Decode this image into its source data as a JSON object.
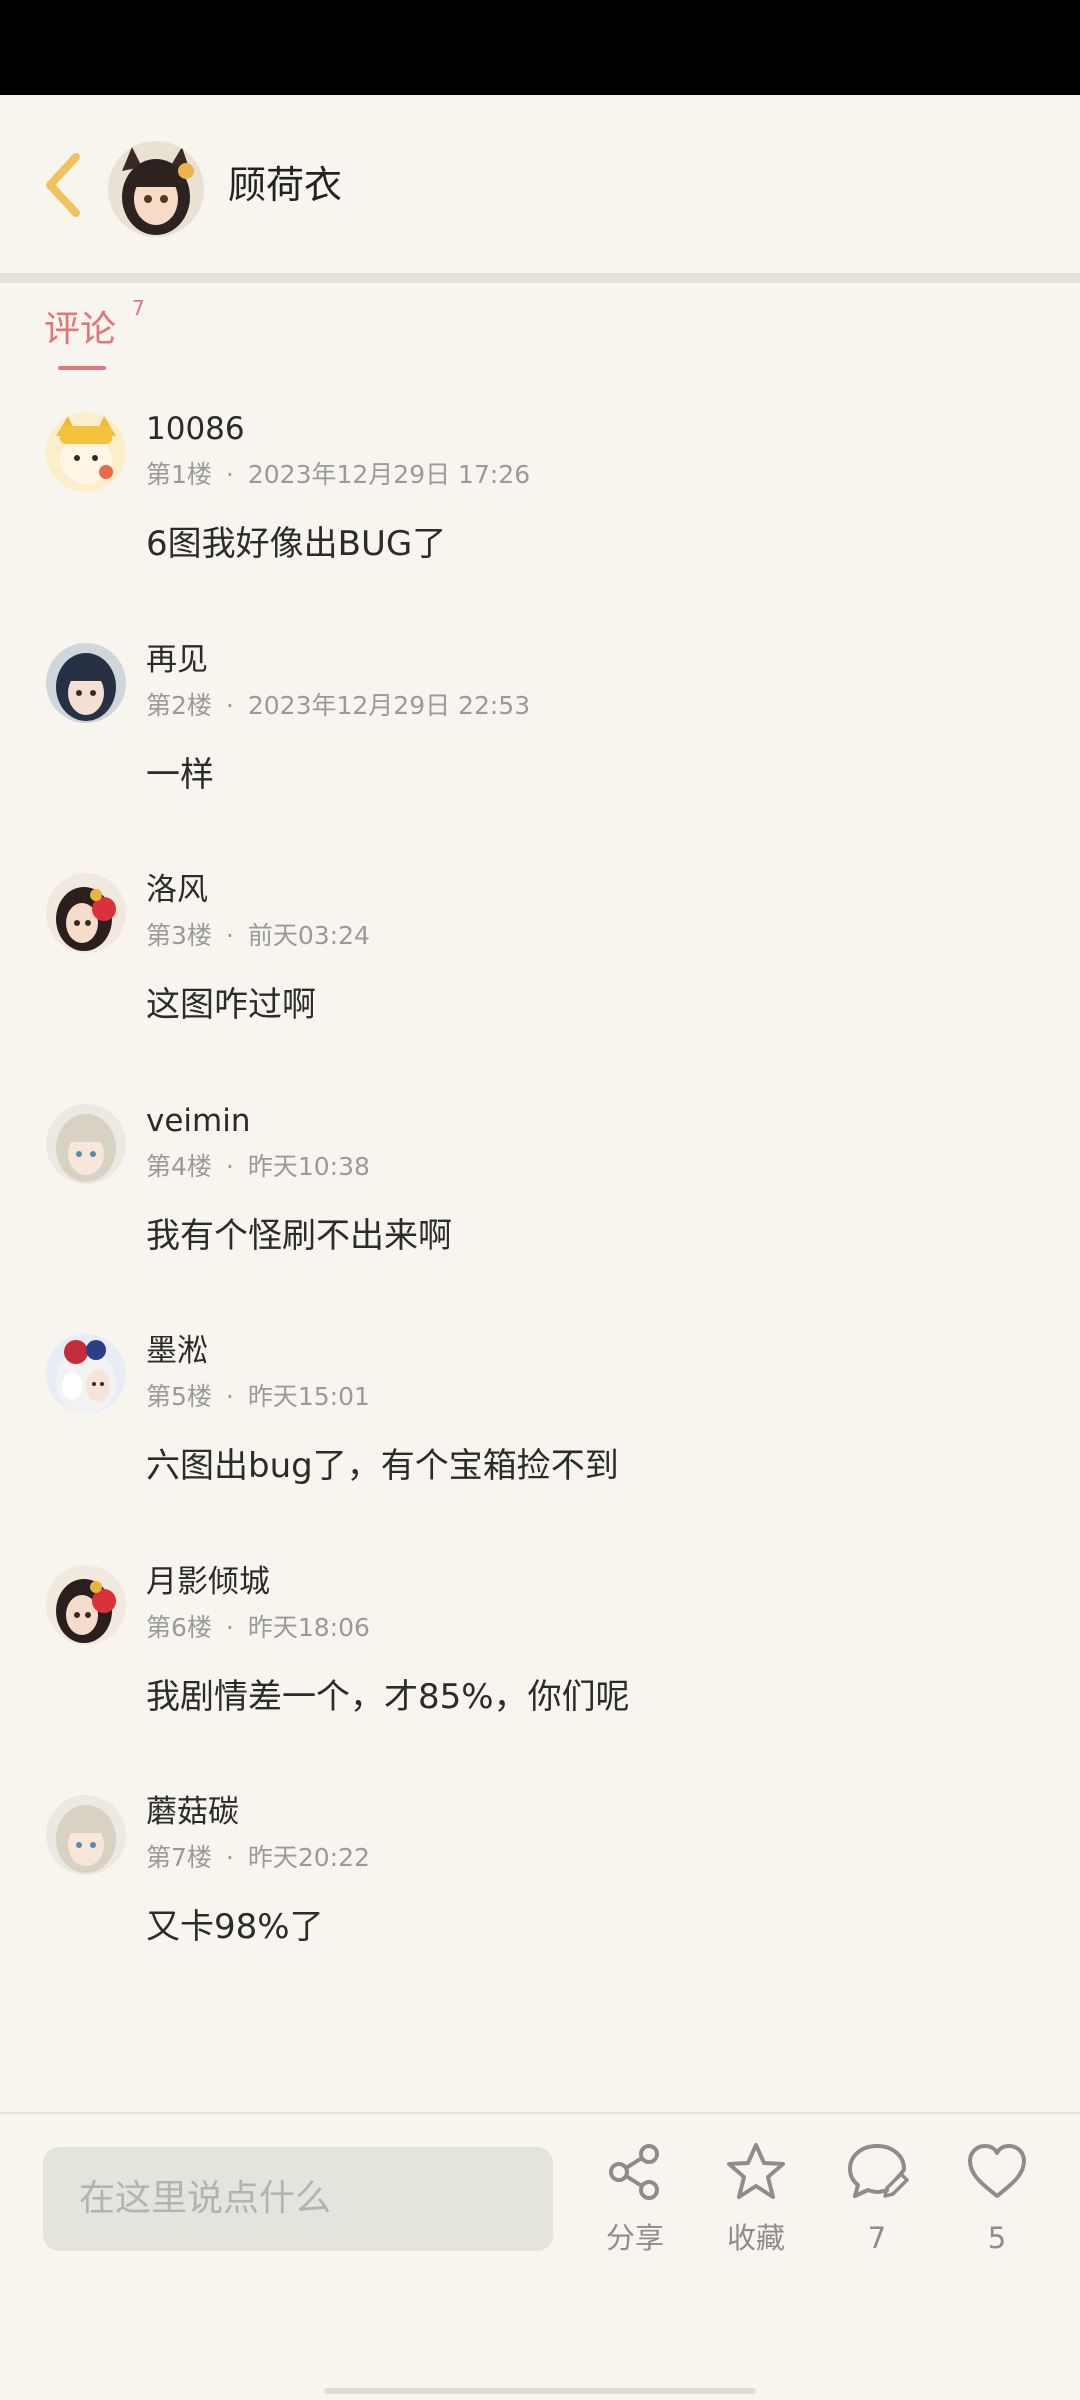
{
  "header": {
    "title": "顾荷衣"
  },
  "tab": {
    "label": "评论",
    "count": "7"
  },
  "comments": [
    {
      "name": "10086",
      "floor": "第1楼",
      "time": "2023年12月29日 17:26",
      "text": "6图我好像出BUG了"
    },
    {
      "name": "再见",
      "floor": "第2楼",
      "time": "2023年12月29日 22:53",
      "text": "一样"
    },
    {
      "name": "洛风",
      "floor": "第3楼",
      "time": "前天03:24",
      "text": "这图咋过啊"
    },
    {
      "name": "veimin",
      "floor": "第4楼",
      "time": "昨天10:38",
      "text": "我有个怪刷不出来啊"
    },
    {
      "name": "墨淞",
      "floor": "第5楼",
      "time": "昨天15:01",
      "text": "六图出bug了，有个宝箱捡不到"
    },
    {
      "name": "月影倾城",
      "floor": "第6楼",
      "time": "昨天18:06",
      "text": "我剧情差一个，才85%，你们呢"
    },
    {
      "name": "蘑菇碳",
      "floor": "第7楼",
      "time": "昨天20:22",
      "text": "又卡98%了"
    }
  ],
  "meta_separator": "·",
  "bottom_bar": {
    "input_placeholder": "在这里说点什么",
    "share_label": "分享",
    "favorite_label": "收藏",
    "comment_count": "7",
    "like_count": "5"
  },
  "colors": {
    "accent": "#e2747a",
    "background": "#f8f5ee",
    "back_arrow": "#f0c35c"
  }
}
